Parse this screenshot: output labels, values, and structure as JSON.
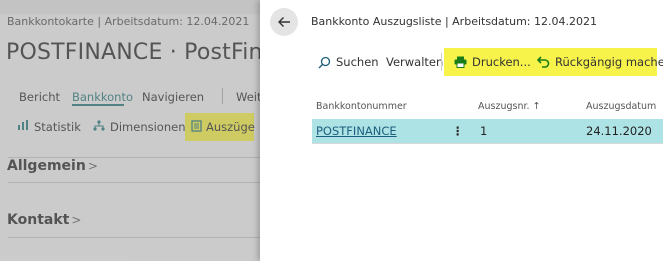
{
  "background_page": {
    "subtitle": "Bankkontokarte | Arbeitsdatum: 12.04.2021",
    "title": "POSTFINANCE · PostFinance",
    "nav": {
      "bericht": "Bericht",
      "bankkonto": "Bankkonto",
      "navigieren": "Navigieren",
      "weitere": "Weite"
    },
    "actions": {
      "statistik": "Statistik",
      "dimensionen": "Dimensionen",
      "auszuege": "Auszüge"
    },
    "sections": {
      "allgemein": "Allgemein",
      "kontakt": "Kontakt"
    }
  },
  "dialog": {
    "title": "Bankkonto Auszugsliste | Arbeitsdatum: 12.04.2021",
    "toolbar": {
      "suchen": "Suchen",
      "verwalten": "Verwalten",
      "drucken": "Drucken...",
      "rueckgaengig": "Rückgängig machen"
    },
    "table": {
      "headers": {
        "bankkontonummer": "Bankkontonummer",
        "auszugsnr": "Auszugsnr. ↑",
        "auszugsdatum": "Auszugsdatum"
      },
      "rows": [
        {
          "bankkontonummer": "POSTFINANCE",
          "menu": "⋮",
          "auszugsnr": "1",
          "auszugsdatum": "24.11.2020"
        }
      ]
    }
  },
  "colors": {
    "highlight": "#f7f34a",
    "selected_row": "#aee3e6",
    "accent": "#2e7d80"
  }
}
